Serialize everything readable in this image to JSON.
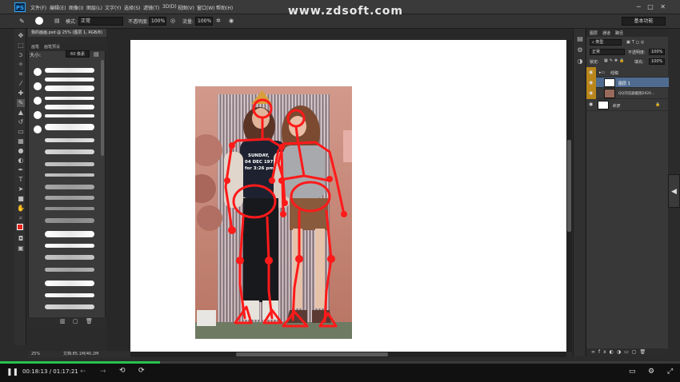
{
  "menubar": {
    "app_badge": "PS",
    "items": [
      "文件(F)",
      "编辑(E)",
      "图像(I)",
      "图层(L)",
      "文字(Y)",
      "选择(S)",
      "滤镜(T)",
      "3D(D)",
      "视图(V)",
      "窗口(W)",
      "帮助(H)"
    ]
  },
  "watermark": "www.zdsoft.com",
  "options": {
    "mode_label": "模式:",
    "mode_value": "正常",
    "opacity_label": "不透明度:",
    "opacity_value": "100%",
    "flow_label": "流量:",
    "flow_value": "100%",
    "workspace": "基本功能"
  },
  "document": {
    "tab_title": "我的画画.psd @ 25% (图层 1, RGB/8)",
    "zoom": "25%",
    "doc_info": "文档:85.1M/40.2M",
    "photo_text_1": "SUNDAY,",
    "photo_text_2": "04 DEC 1971",
    "photo_text_3": "for 3:26 pm"
  },
  "brushes": {
    "tabs": [
      "画笔",
      "画笔预设"
    ],
    "size_label": "大小:",
    "size_value": "60 像素"
  },
  "layers": {
    "tabs": [
      "图层",
      "通道",
      "路径"
    ],
    "kind_label": "类型",
    "blend_mode": "正常",
    "opacity_label": "不透明度:",
    "opacity_value": "100%",
    "lock_label": "锁定:",
    "fill_label": "填充:",
    "fill_value": "100%",
    "group_name": "线稿",
    "layer1_name": "图层 1",
    "layer2_name": "QQ浏览器截图2020...",
    "bg_label": "背景"
  },
  "player": {
    "current_time": "00:18:13",
    "separator": "/",
    "total_time": "01:17:21",
    "progress": 0.235
  },
  "colors": {
    "accent_green": "#27c24c",
    "sketch_red": "#ff1a1a",
    "fg_color": "#e8241e",
    "bg_color": "#ffffff"
  },
  "icons": [
    "play-pause-icon",
    "prev-icon",
    "next-icon",
    "rewind-icon",
    "forward-icon",
    "subtitle-icon",
    "settings-icon",
    "fullscreen-icon"
  ]
}
